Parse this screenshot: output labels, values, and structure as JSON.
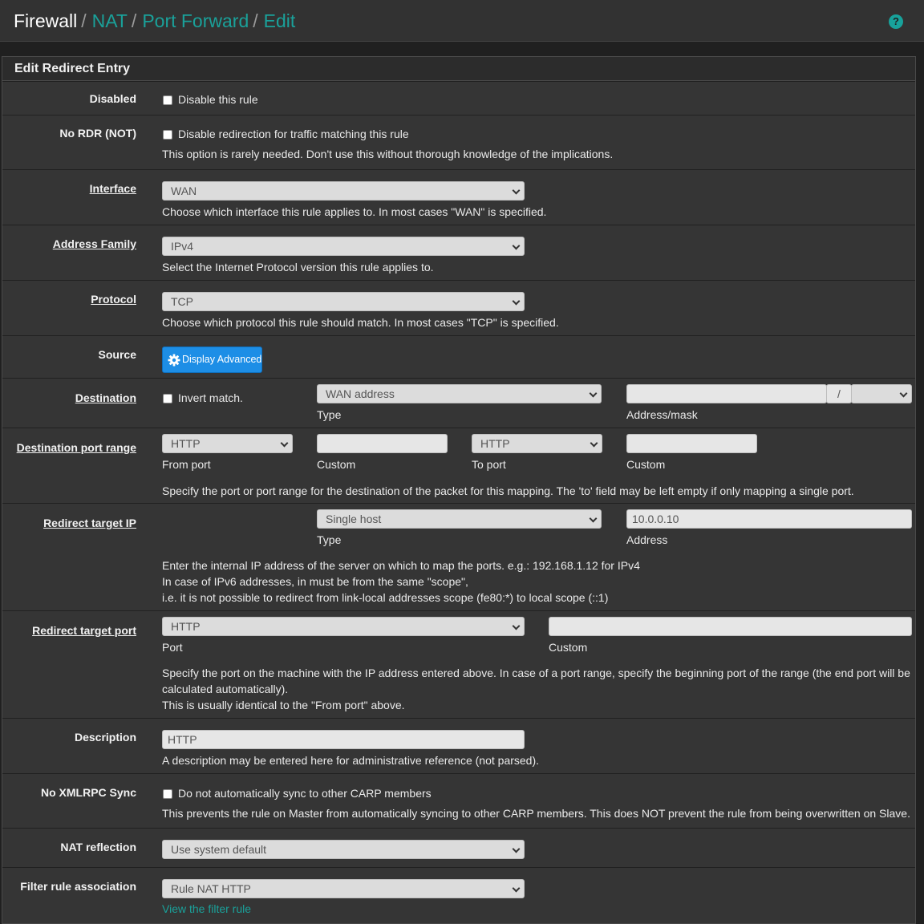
{
  "breadcrumb": [
    "Firewall",
    "NAT",
    "Port Forward",
    "Edit"
  ],
  "panel_title": "Edit Redirect Entry",
  "disabled": {
    "label": "Disabled",
    "checkbox_label": "Disable this rule"
  },
  "no_rdr": {
    "label": "No RDR (NOT)",
    "checkbox_label": "Disable redirection for traffic matching this rule",
    "help": "This option is rarely needed. Don't use this without thorough knowledge of the implications."
  },
  "interface": {
    "label": "Interface",
    "value": "WAN",
    "help": "Choose which interface this rule applies to. In most cases \"WAN\" is specified."
  },
  "address_family": {
    "label": "Address Family",
    "value": "IPv4",
    "help": "Select the Internet Protocol version this rule applies to."
  },
  "protocol": {
    "label": "Protocol",
    "value": "TCP",
    "help": "Choose which protocol this rule should match. In most cases \"TCP\" is specified."
  },
  "source": {
    "label": "Source",
    "button_label": "Display Advanced"
  },
  "destination": {
    "label": "Destination",
    "invert_label": "Invert match.",
    "type_value": "WAN address",
    "type_caption": "Type",
    "address_value": "",
    "mask_sep": "/",
    "mask_value": "",
    "address_caption": "Address/mask"
  },
  "dest_port": {
    "label": "Destination port range",
    "from_value": "HTTP",
    "from_caption": "From port",
    "from_custom": "",
    "custom_caption": "Custom",
    "to_value": "HTTP",
    "to_caption": "To port",
    "to_custom": "",
    "help": "Specify the port or port range for the destination of the packet for this mapping. The 'to' field may be left empty if only mapping a single port."
  },
  "redirect_ip": {
    "label": "Redirect target IP",
    "type_value": "Single host",
    "type_caption": "Type",
    "address_placeholder": "10.0.0.10",
    "address_caption": "Address",
    "help1": "Enter the internal IP address of the server on which to map the ports. e.g.: 192.168.1.12 for IPv4",
    "help2": "In case of IPv6 addresses, in must be from the same \"scope\",",
    "help3": "i.e. it is not possible to redirect from link-local addresses scope (fe80:*) to local scope (::1)"
  },
  "redirect_port": {
    "label": "Redirect target port",
    "value": "HTTP",
    "port_caption": "Port",
    "custom": "",
    "custom_caption": "Custom",
    "help1": "Specify the port on the machine with the IP address entered above. In case of a port range, specify the beginning port of the range (the end port will be",
    "help2": "calculated automatically).",
    "help3": "This is usually identical to the \"From port\" above."
  },
  "description": {
    "label": "Description",
    "placeholder": "HTTP",
    "help": "A description may be entered here for administrative reference (not parsed)."
  },
  "xmlrpc": {
    "label": "No XMLRPC Sync",
    "checkbox_label": "Do not automatically sync to other CARP members",
    "help": "This prevents the rule on Master from automatically syncing to other CARP members. This does NOT prevent the rule from being overwritten on Slave."
  },
  "nat_reflection": {
    "label": "NAT reflection",
    "value": "Use system default"
  },
  "filter_rule": {
    "label": "Filter rule association",
    "value": "Rule NAT HTTP",
    "link": "View the filter rule"
  },
  "colors": {
    "background": "#202020",
    "panel": "#353535",
    "accent": "#1aa19a",
    "button": "#1d8ee6"
  }
}
